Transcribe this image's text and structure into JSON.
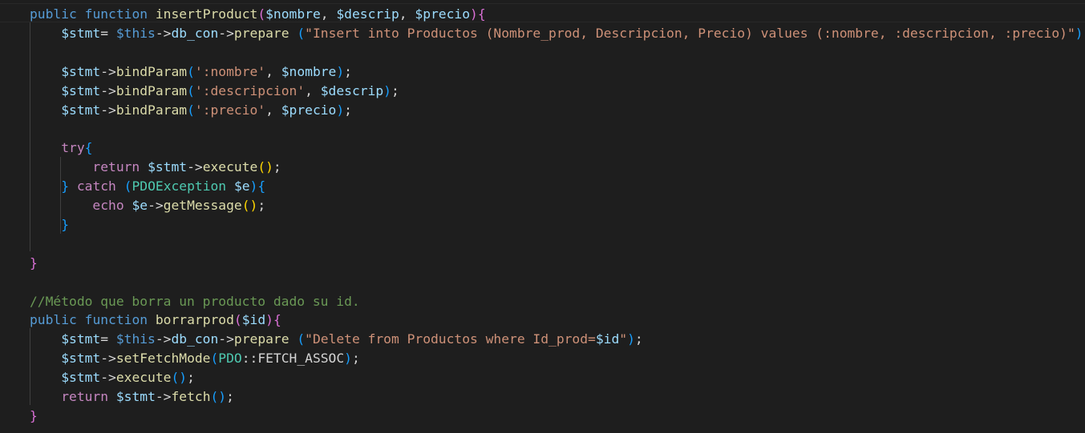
{
  "editor": {
    "language": "php",
    "theme": "dark",
    "colors": {
      "background": "#1e1e1e",
      "keyword": "#569cd6",
      "control": "#c586c0",
      "function": "#dcdcaa",
      "variable": "#9cdcfe",
      "string": "#ce9178",
      "class": "#4ec9b0",
      "comment": "#6a9955",
      "bracket_level_1": "#da70d6",
      "bracket_level_2": "#179fff",
      "bracket_level_3": "#ffd700"
    },
    "lines": [
      {
        "tokens": [
          {
            "t": "public",
            "c": "kw"
          },
          {
            "t": " ",
            "c": "punc"
          },
          {
            "t": "function",
            "c": "kw"
          },
          {
            "t": " ",
            "c": "punc"
          },
          {
            "t": "insertProduct",
            "c": "fn"
          },
          {
            "t": "(",
            "c": "b1"
          },
          {
            "t": "$nombre",
            "c": "var"
          },
          {
            "t": ", ",
            "c": "punc"
          },
          {
            "t": "$descrip",
            "c": "var"
          },
          {
            "t": ", ",
            "c": "punc"
          },
          {
            "t": "$precio",
            "c": "var"
          },
          {
            "t": ")",
            "c": "b1"
          },
          {
            "t": "{",
            "c": "b1"
          }
        ]
      },
      {
        "tokens": [
          {
            "t": "    ",
            "c": "punc"
          },
          {
            "t": "$stmt",
            "c": "var"
          },
          {
            "t": "= ",
            "c": "punc"
          },
          {
            "t": "$this",
            "c": "kw"
          },
          {
            "t": "->",
            "c": "punc"
          },
          {
            "t": "db_con",
            "c": "var"
          },
          {
            "t": "->",
            "c": "punc"
          },
          {
            "t": "prepare",
            "c": "fn"
          },
          {
            "t": " ",
            "c": "punc"
          },
          {
            "t": "(",
            "c": "b2"
          },
          {
            "t": "\"Insert into Productos (Nombre_prod, Descripcion, Precio) values (:nombre, :descripcion, :precio)\"",
            "c": "str"
          },
          {
            "t": ")",
            "c": "b2"
          },
          {
            "t": ";",
            "c": "punc"
          }
        ]
      },
      {
        "tokens": []
      },
      {
        "tokens": [
          {
            "t": "    ",
            "c": "punc"
          },
          {
            "t": "$stmt",
            "c": "var"
          },
          {
            "t": "->",
            "c": "punc"
          },
          {
            "t": "bindParam",
            "c": "fn"
          },
          {
            "t": "(",
            "c": "b2"
          },
          {
            "t": "':nombre'",
            "c": "str"
          },
          {
            "t": ", ",
            "c": "punc"
          },
          {
            "t": "$nombre",
            "c": "var"
          },
          {
            "t": ")",
            "c": "b2"
          },
          {
            "t": ";",
            "c": "punc"
          }
        ]
      },
      {
        "tokens": [
          {
            "t": "    ",
            "c": "punc"
          },
          {
            "t": "$stmt",
            "c": "var"
          },
          {
            "t": "->",
            "c": "punc"
          },
          {
            "t": "bindParam",
            "c": "fn"
          },
          {
            "t": "(",
            "c": "b2"
          },
          {
            "t": "':descripcion'",
            "c": "str"
          },
          {
            "t": ", ",
            "c": "punc"
          },
          {
            "t": "$descrip",
            "c": "var"
          },
          {
            "t": ")",
            "c": "b2"
          },
          {
            "t": ";",
            "c": "punc"
          }
        ]
      },
      {
        "tokens": [
          {
            "t": "    ",
            "c": "punc"
          },
          {
            "t": "$stmt",
            "c": "var"
          },
          {
            "t": "->",
            "c": "punc"
          },
          {
            "t": "bindParam",
            "c": "fn"
          },
          {
            "t": "(",
            "c": "b2"
          },
          {
            "t": "':precio'",
            "c": "str"
          },
          {
            "t": ", ",
            "c": "punc"
          },
          {
            "t": "$precio",
            "c": "var"
          },
          {
            "t": ")",
            "c": "b2"
          },
          {
            "t": ";",
            "c": "punc"
          }
        ]
      },
      {
        "tokens": []
      },
      {
        "tokens": [
          {
            "t": "    ",
            "c": "punc"
          },
          {
            "t": "try",
            "c": "ctl"
          },
          {
            "t": "{",
            "c": "b2"
          }
        ]
      },
      {
        "tokens": [
          {
            "t": "        ",
            "c": "punc"
          },
          {
            "t": "return",
            "c": "ctl"
          },
          {
            "t": " ",
            "c": "punc"
          },
          {
            "t": "$stmt",
            "c": "var"
          },
          {
            "t": "->",
            "c": "punc"
          },
          {
            "t": "execute",
            "c": "fn"
          },
          {
            "t": "()",
            "c": "b3"
          },
          {
            "t": ";",
            "c": "punc"
          }
        ]
      },
      {
        "tokens": [
          {
            "t": "    ",
            "c": "punc"
          },
          {
            "t": "}",
            "c": "b2"
          },
          {
            "t": " ",
            "c": "punc"
          },
          {
            "t": "catch",
            "c": "ctl"
          },
          {
            "t": " ",
            "c": "punc"
          },
          {
            "t": "(",
            "c": "b2"
          },
          {
            "t": "PDOException",
            "c": "cls"
          },
          {
            "t": " ",
            "c": "punc"
          },
          {
            "t": "$e",
            "c": "var"
          },
          {
            "t": ")",
            "c": "b2"
          },
          {
            "t": "{",
            "c": "b2"
          }
        ]
      },
      {
        "tokens": [
          {
            "t": "        ",
            "c": "punc"
          },
          {
            "t": "echo",
            "c": "ctl"
          },
          {
            "t": " ",
            "c": "punc"
          },
          {
            "t": "$e",
            "c": "var"
          },
          {
            "t": "->",
            "c": "punc"
          },
          {
            "t": "getMessage",
            "c": "fn"
          },
          {
            "t": "()",
            "c": "b3"
          },
          {
            "t": ";",
            "c": "punc"
          }
        ]
      },
      {
        "tokens": [
          {
            "t": "    ",
            "c": "punc"
          },
          {
            "t": "}",
            "c": "b2"
          }
        ]
      },
      {
        "tokens": []
      },
      {
        "tokens": [
          {
            "t": "}",
            "c": "b1"
          }
        ]
      },
      {
        "tokens": []
      },
      {
        "tokens": [
          {
            "t": "//Método que borra un producto dado su id.",
            "c": "cmt"
          }
        ]
      },
      {
        "tokens": [
          {
            "t": "public",
            "c": "kw"
          },
          {
            "t": " ",
            "c": "punc"
          },
          {
            "t": "function",
            "c": "kw"
          },
          {
            "t": " ",
            "c": "punc"
          },
          {
            "t": "borrarprod",
            "c": "fn"
          },
          {
            "t": "(",
            "c": "b1"
          },
          {
            "t": "$id",
            "c": "var"
          },
          {
            "t": ")",
            "c": "b1"
          },
          {
            "t": "{",
            "c": "b1"
          }
        ]
      },
      {
        "tokens": [
          {
            "t": "    ",
            "c": "punc"
          },
          {
            "t": "$stmt",
            "c": "var"
          },
          {
            "t": "= ",
            "c": "punc"
          },
          {
            "t": "$this",
            "c": "kw"
          },
          {
            "t": "->",
            "c": "punc"
          },
          {
            "t": "db_con",
            "c": "var"
          },
          {
            "t": "->",
            "c": "punc"
          },
          {
            "t": "prepare",
            "c": "fn"
          },
          {
            "t": " ",
            "c": "punc"
          },
          {
            "t": "(",
            "c": "b2"
          },
          {
            "t": "\"Delete from Productos where Id_prod=",
            "c": "str"
          },
          {
            "t": "$id",
            "c": "var"
          },
          {
            "t": "\"",
            "c": "str"
          },
          {
            "t": ")",
            "c": "b2"
          },
          {
            "t": ";",
            "c": "punc"
          }
        ]
      },
      {
        "tokens": [
          {
            "t": "    ",
            "c": "punc"
          },
          {
            "t": "$stmt",
            "c": "var"
          },
          {
            "t": "->",
            "c": "punc"
          },
          {
            "t": "setFetchMode",
            "c": "fn"
          },
          {
            "t": "(",
            "c": "b2"
          },
          {
            "t": "PDO",
            "c": "cls"
          },
          {
            "t": "::",
            "c": "punc"
          },
          {
            "t": "FETCH_ASSOC",
            "c": "punc"
          },
          {
            "t": ")",
            "c": "b2"
          },
          {
            "t": ";",
            "c": "punc"
          }
        ]
      },
      {
        "tokens": [
          {
            "t": "    ",
            "c": "punc"
          },
          {
            "t": "$stmt",
            "c": "var"
          },
          {
            "t": "->",
            "c": "punc"
          },
          {
            "t": "execute",
            "c": "fn"
          },
          {
            "t": "()",
            "c": "b2"
          },
          {
            "t": ";",
            "c": "punc"
          }
        ]
      },
      {
        "tokens": [
          {
            "t": "    ",
            "c": "punc"
          },
          {
            "t": "return",
            "c": "ctl"
          },
          {
            "t": " ",
            "c": "punc"
          },
          {
            "t": "$stmt",
            "c": "var"
          },
          {
            "t": "->",
            "c": "punc"
          },
          {
            "t": "fetch",
            "c": "fn"
          },
          {
            "t": "()",
            "c": "b2"
          },
          {
            "t": ";",
            "c": "punc"
          }
        ]
      },
      {
        "tokens": [
          {
            "t": "}",
            "c": "b1"
          }
        ]
      }
    ]
  }
}
